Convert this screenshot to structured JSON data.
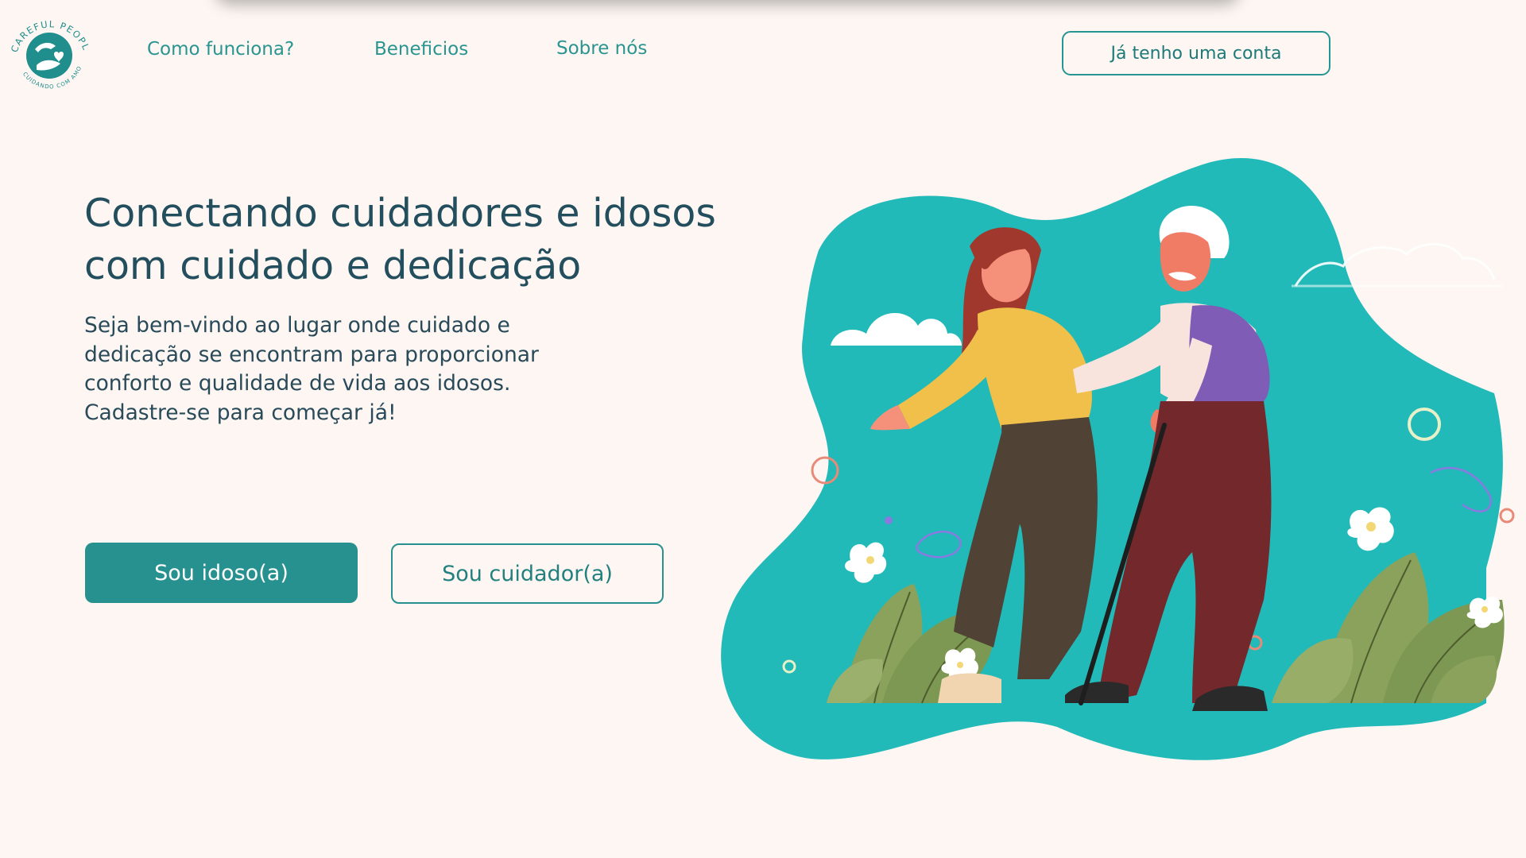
{
  "header": {
    "logo": {
      "brand_text": "CAREFUL PEOPLE",
      "tagline": "CUIDANDO COM AMOR",
      "brand_color": "#1f8e8c"
    },
    "nav": [
      {
        "label": "Como funciona?"
      },
      {
        "label": "Beneficios"
      },
      {
        "label": "Sobre nós"
      }
    ],
    "login_label": "Já tenho uma conta"
  },
  "hero": {
    "title": "Conectando cuidadores e idosos com cuidado e dedicação",
    "description": "Seja bem-vindo ao lugar onde cuidado e dedicação se encontram para proporcionar conforto e qualidade de vida aos idosos. Cadastre-se para começar já!",
    "primary_button": "Sou idoso(a)",
    "secondary_button": "Sou cuidador(a)"
  },
  "colors": {
    "background": "#fdf6f2",
    "accent": "#27918f",
    "heading": "#234e5d",
    "blob": "#22bab8"
  },
  "icons": {
    "logo": "hands-heart-logo",
    "illustration": "caregiver-walking-with-elderly-man"
  }
}
